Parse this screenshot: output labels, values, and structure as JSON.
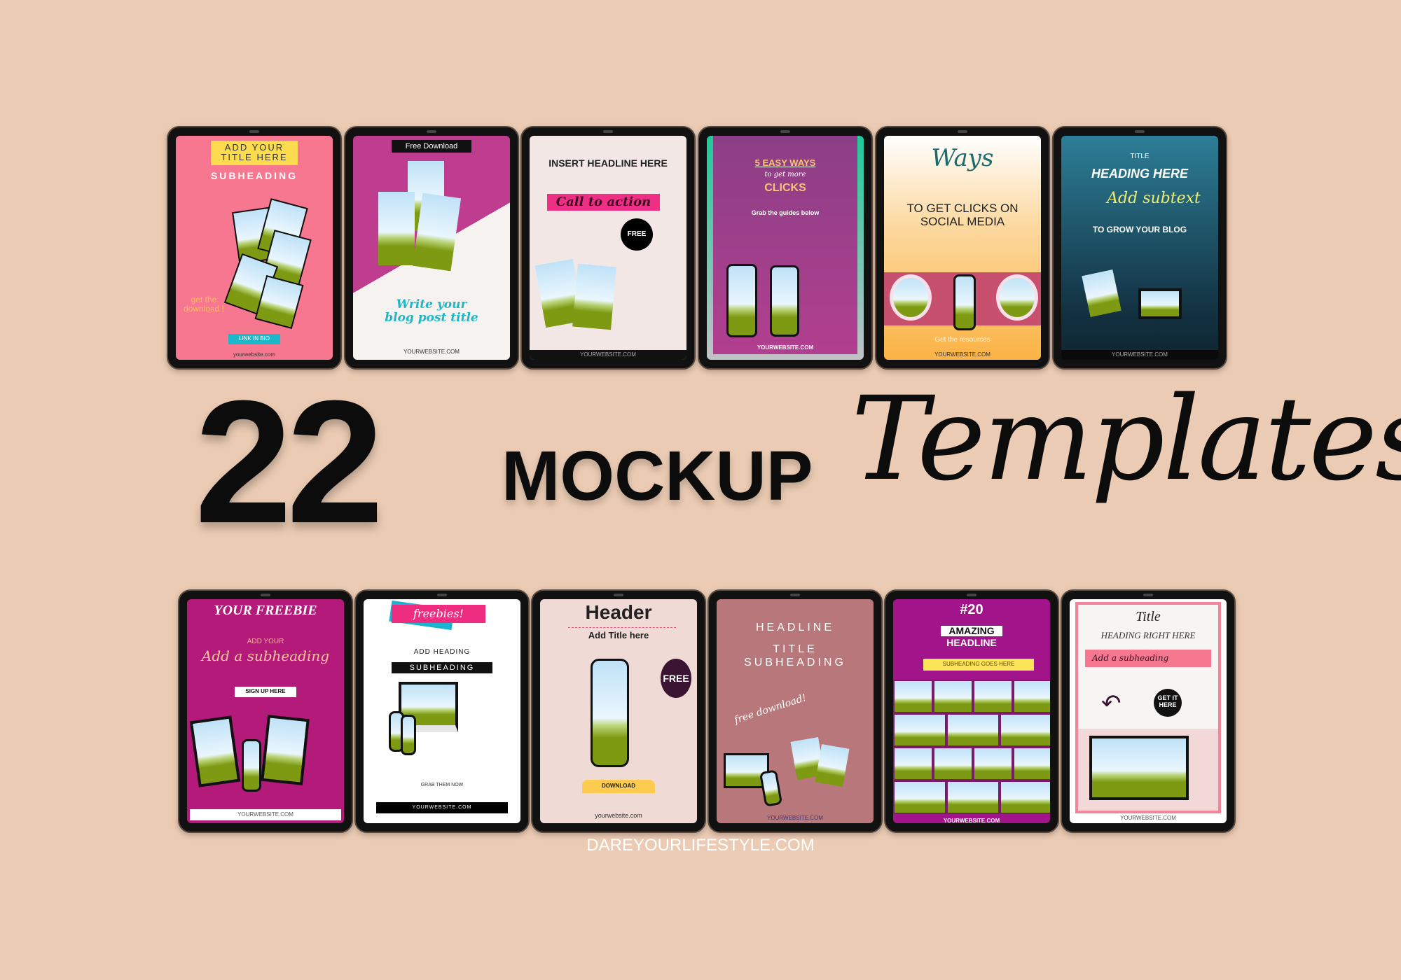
{
  "headline": {
    "number": "22",
    "word": "MOCKUP",
    "script": "Templates"
  },
  "footer_site": "DAREYOURLIFESTYLE.COM",
  "colors": {
    "background": "#ebcbb3",
    "tablet_frame": "#111111"
  },
  "top_row": [
    {
      "title": "ADD YOUR TITLE HERE",
      "subheading": "SUBHEADING",
      "note": "get the download !",
      "button": "LINK IN BIO",
      "site": "yourwebsite.com"
    },
    {
      "ribbon": "Free Download",
      "title": "Write your blog post title",
      "site": "YOURWEBSITE.COM"
    },
    {
      "headline": "INSERT HEADLINE HERE",
      "cta": "Call to action",
      "badge": "FREE",
      "site": "YOURWEBSITE.COM"
    },
    {
      "line1": "5 EASY WAYS",
      "line2": "to get more",
      "line3": "CLICKS",
      "line4": "Grab the guides below",
      "site": "YOURWEBSITE.COM"
    },
    {
      "script": "Ways",
      "headline": "TO GET CLICKS ON SOCIAL MEDIA",
      "sub": "Get the resources",
      "site": "YOURWEBSITE.COM"
    },
    {
      "label": "TITLE",
      "heading": "HEADING HERE",
      "script": "Add subtext",
      "sub": "TO GROW YOUR BLOG",
      "site": "YOURWEBSITE.COM"
    }
  ],
  "bottom_row": [
    {
      "title": "YOUR FREEBIE",
      "small": "ADD YOUR",
      "script": "Add a subheading",
      "button": "SIGN UP HERE",
      "site": "YOURWEBSITE.COM"
    },
    {
      "ribbon": "freebies!",
      "heading": "ADD HEADING",
      "sub": "SUBHEADING",
      "cta": "GRAB THEM NOW",
      "site": "YOURWEBSITE.COM"
    },
    {
      "header": "Header",
      "title": "Add Title here",
      "badge": "FREE",
      "ribbon": "DOWNLOAD",
      "site": "yourwebsite.com"
    },
    {
      "headline": "HEADLINE",
      "title": "TITLE",
      "sub": "SUBHEADING",
      "script": "free download!",
      "site": "YOURWEBSITE.COM"
    },
    {
      "number": "#20",
      "line1": "AMAZING",
      "line2": "HEADLINE",
      "sub": "SUBHEADING GOES HERE",
      "site": "YOURWEBSITE.COM"
    },
    {
      "title": "Title",
      "heading": "HEADING RIGHT HERE",
      "script": "Add a subheading",
      "badge": "GET IT HERE",
      "site": "YOURWEBSITE.COM"
    }
  ]
}
